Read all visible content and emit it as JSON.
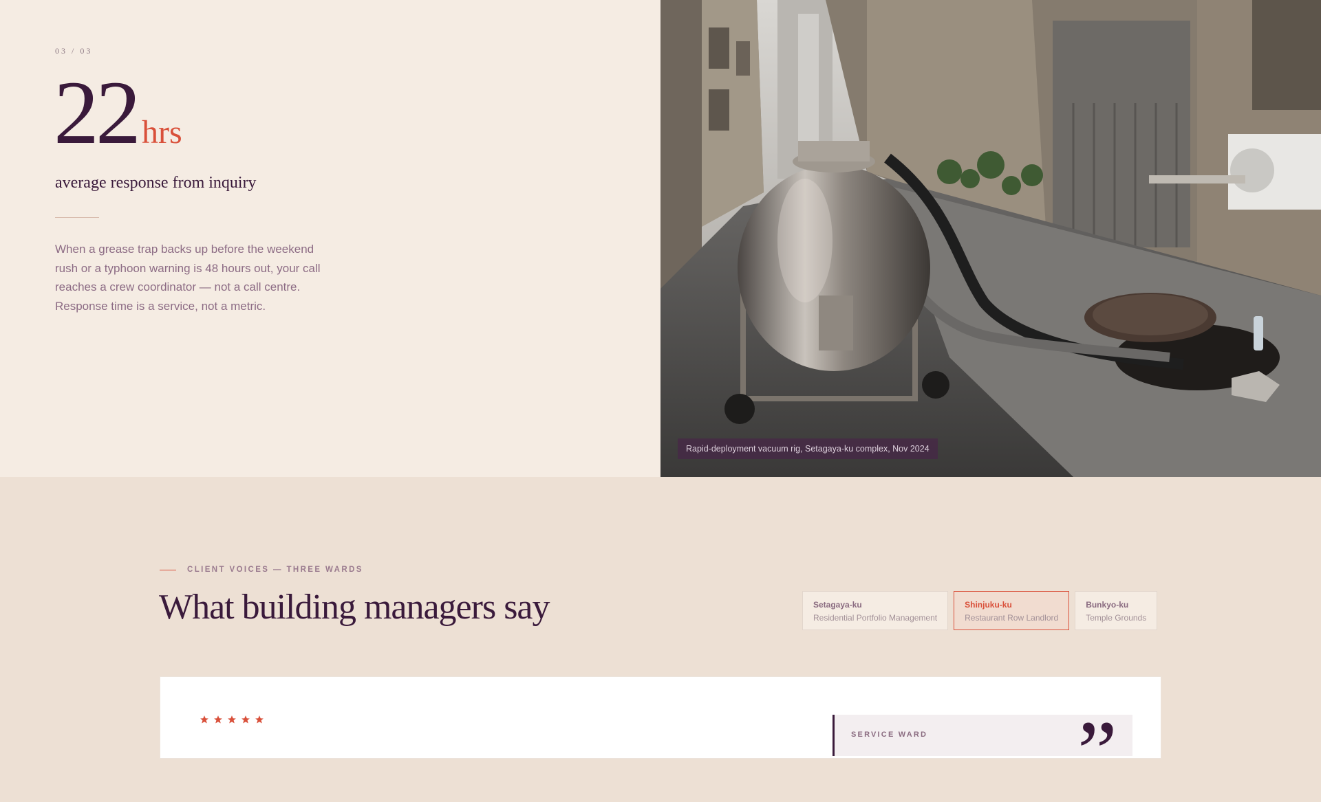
{
  "stat": {
    "counter": "03 / 03",
    "value": "22",
    "unit": "hrs",
    "label": "average response from inquiry",
    "body": "When a grease trap backs up before the weekend rush or a typhoon warning is 48 hours out, your call reaches a crew coordinator — not a call centre. Response time is a service, not a metric."
  },
  "photo": {
    "caption": "Rapid-deployment vacuum rig, Setagaya-ku complex, Nov 2024"
  },
  "testimonials": {
    "kicker": "CLIENT VOICES — THREE WARDS",
    "heading": "What building managers say",
    "tabs": [
      {
        "ward": "Setagaya-ku",
        "role": "Residential Portfolio Management",
        "active": false
      },
      {
        "ward": "Shinjuku-ku",
        "role": "Restaurant Row Landlord",
        "active": true
      },
      {
        "ward": "Bunkyo-ku",
        "role": "Temple Grounds",
        "active": false
      }
    ],
    "rating": 5,
    "aside_label": "SERVICE WARD",
    "quote_mark": "”"
  },
  "colors": {
    "accent": "#d9503a",
    "ink": "#3a1a3b",
    "muted": "#8c6b84"
  }
}
